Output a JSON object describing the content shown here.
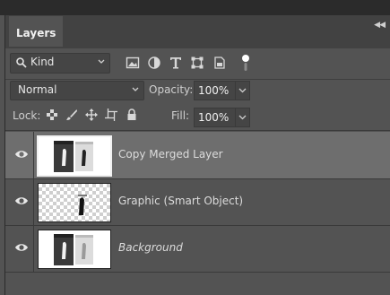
{
  "panel": {
    "tab_label": "Layers"
  },
  "filter": {
    "kind_label": "Kind"
  },
  "blend": {
    "mode": "Normal",
    "opacity_label": "Opacity:",
    "opacity_value": "100%"
  },
  "lock": {
    "label": "Lock:",
    "fill_label": "Fill:",
    "fill_value": "100%"
  },
  "layers": [
    {
      "name": "Copy Merged Layer",
      "selected": true,
      "visible": true
    },
    {
      "name": "Graphic (Smart Object)",
      "selected": false,
      "visible": true
    },
    {
      "name": "Background",
      "selected": false,
      "visible": true
    }
  ],
  "icons": [
    "search-icon",
    "chevron-down-icon",
    "pixel-filter-icon",
    "adjustment-filter-icon",
    "type-filter-icon",
    "shape-filter-icon",
    "smart-object-filter-icon",
    "filter-toggle-icon",
    "lock-transparent-icon",
    "lock-image-icon",
    "lock-position-icon",
    "lock-artboard-icon",
    "lock-all-icon",
    "eye-icon"
  ]
}
